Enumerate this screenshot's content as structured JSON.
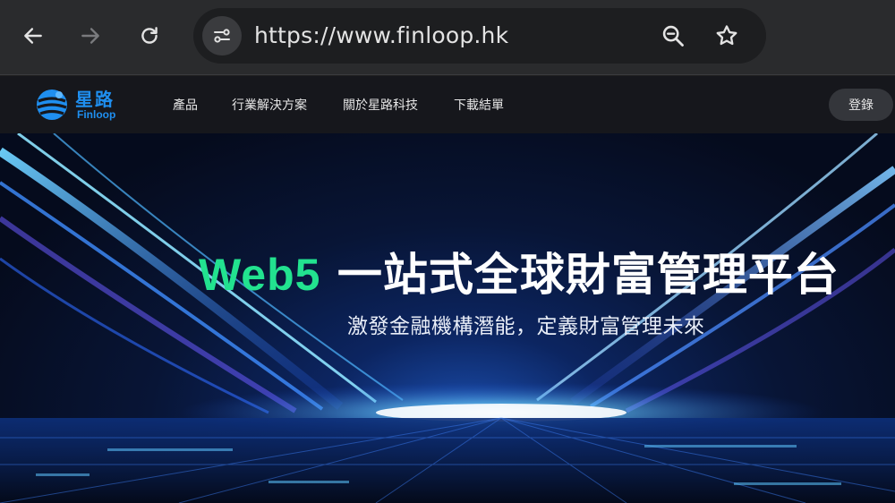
{
  "browser": {
    "url": "https://www.finloop.hk",
    "icons": [
      "back-arrow-icon",
      "forward-arrow-icon",
      "reload-icon",
      "site-settings-icon",
      "zoom-icon",
      "bookmark-star-icon"
    ]
  },
  "site": {
    "logo": {
      "cn": "星路",
      "en": "Finloop"
    },
    "menu": [
      {
        "label": "產品"
      },
      {
        "label": "行業解決方案"
      },
      {
        "label": "關於星路科技"
      },
      {
        "label": "下載結單"
      }
    ],
    "login_label": "登錄",
    "brand_color": "#1f8ff0"
  },
  "hero": {
    "title_accent": "Web5",
    "title_main": "一站式全球財富管理平台",
    "subtitle": "激發金融機構潛能，定義財富管理未來",
    "accent_color": "#22e28f"
  }
}
